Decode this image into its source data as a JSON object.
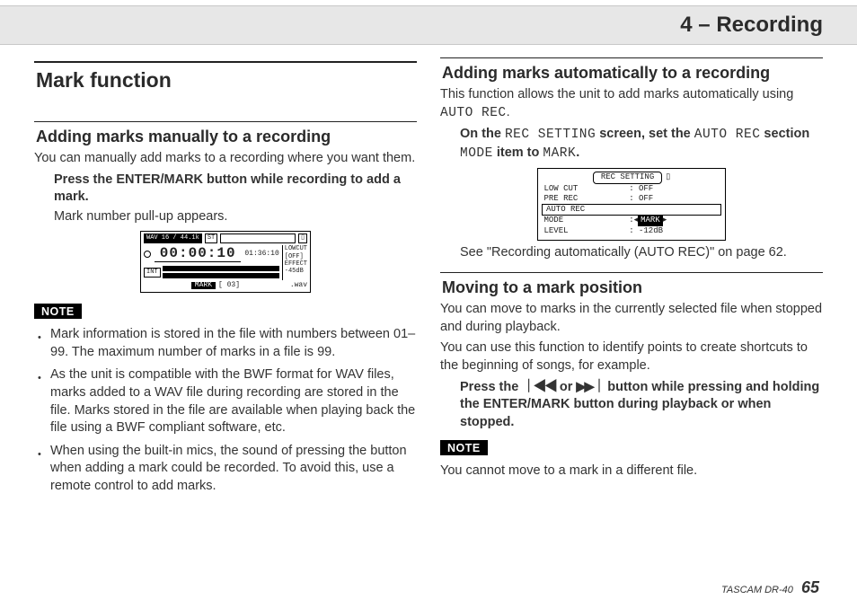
{
  "header": {
    "chapter": "4 – Recording"
  },
  "left": {
    "major_heading": "Mark function",
    "section1": {
      "heading": "Adding marks manually to a recording",
      "intro": "You can manually add marks to a recording where you want them.",
      "step": "Press the ENTER/MARK button while recording to add a mark.",
      "step_after": "Mark number pull-up appears."
    },
    "lcd1": {
      "fmt": "WAV 16 / 44.1k",
      "ch": "ST",
      "time": "00:00:10",
      "remain": "01:36:10",
      "side_lowcut": "LOWCUT",
      "side_off": "[OFF]",
      "side_effect": "EFFECT",
      "side_db": "-45dB",
      "int": "INT",
      "mark": "MARK",
      "mark_num": "[ 03]",
      "ext": ".wav"
    },
    "note_label": "NOTE",
    "notes": [
      "Mark information is stored in the file with numbers between 01–99. The maximum number of marks in a file is 99.",
      "As the unit is compatible with the BWF format for WAV files, marks added to a WAV file during recording are stored in the file. Marks stored in the file are available when playing back the file using a BWF compliant software, etc.",
      "When using the built-in mics, the sound of pressing the button when adding a mark could be recorded. To avoid this, use a remote control to add marks."
    ]
  },
  "right": {
    "section2": {
      "heading": "Adding marks automatically to a recording",
      "intro_a": "This function allows the unit to add marks automatically using ",
      "intro_lcd": "AUTO REC",
      "intro_b": ".",
      "step_a": "On the ",
      "step_l1": "REC SETTING",
      "step_b": " screen, set the ",
      "step_l2": "AUTO REC",
      "step_c": " section ",
      "step_l3": "MODE",
      "step_d": " item to ",
      "step_l4": "MARK",
      "step_e": ".",
      "after": "See \"Recording automatically (AUTO REC)\" on page 62."
    },
    "lcd2": {
      "title": "REC SETTING",
      "rows": [
        {
          "k": "LOW CUT",
          "v": ": OFF"
        },
        {
          "k": "PRE REC",
          "v": ": OFF"
        }
      ],
      "grp": "AUTO REC",
      "mode_k": "MODE",
      "mode_v": "MARK",
      "level_k": "LEVEL",
      "level_v": ": -12dB"
    },
    "section3": {
      "heading": "Moving to a mark position",
      "p1": "You can move to marks in the currently selected file when stopped and during playback.",
      "p2": "You can use this function to identify points to create shortcuts to the beginning of songs, for example.",
      "step_a": "Press the ",
      "step_b": " or ",
      "step_c": " button while pressing and holding the ENTER/MARK button during playback or when stopped.",
      "icon_prev": "⏮",
      "icon_next": "⏭"
    },
    "note_label": "NOTE",
    "note_text": "You cannot move to a mark in a different file."
  },
  "footer": {
    "model": "TASCAM DR-40",
    "page": "65"
  }
}
